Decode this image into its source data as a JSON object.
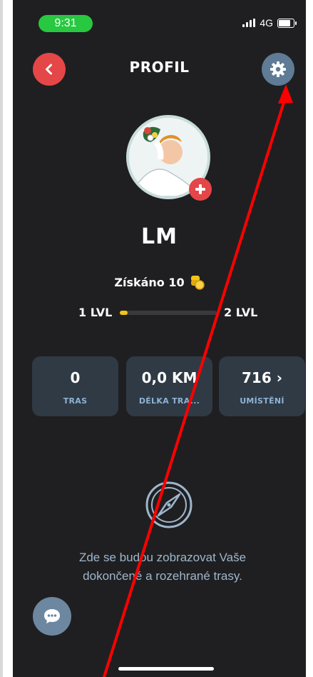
{
  "status_bar": {
    "time": "9:31",
    "network": "4G"
  },
  "header": {
    "title": "PROFIL",
    "back_icon": "chevron-left-icon",
    "settings_icon": "gear-icon"
  },
  "profile": {
    "name": "LM",
    "earned_label": "Získáno 10",
    "coin_icon": "coin-stack-icon",
    "level_current": "1 LVL",
    "level_next": "2 LVL",
    "level_progress": 0.08
  },
  "stats": [
    {
      "value": "0",
      "label": "TRAS"
    },
    {
      "value": "0,0 KM",
      "label": "DÉLKA TRA..."
    },
    {
      "value": "716 ›",
      "label": "UMÍSTĚNÍ"
    }
  ],
  "empty_state": {
    "icon": "compass-icon",
    "text": "Zde se budou zobrazovat Vaše dokončené a rozehrané trasy."
  },
  "chat_icon": "chat-bubble-icon",
  "colors": {
    "background": "#1f1f21",
    "accent_red": "#e54647",
    "card": "#2f3a45",
    "muted_blue": "#9fb6cc",
    "progress": "#f0c419",
    "status_green": "#28c840",
    "annotation_arrow": "#ff0000"
  }
}
